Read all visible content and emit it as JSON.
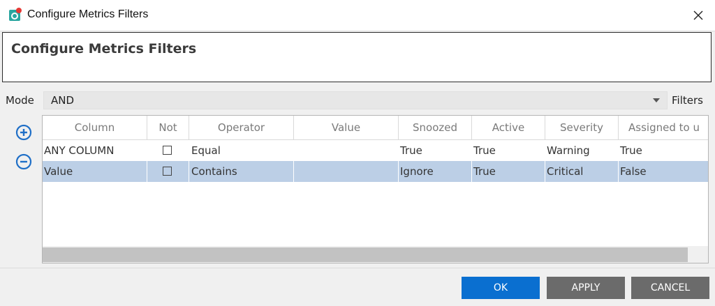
{
  "window": {
    "title": "Configure Metrics Filters"
  },
  "header": {
    "title": "Configure Metrics Filters"
  },
  "mode": {
    "label": "Mode",
    "value": "AND",
    "filters_label": "Filters"
  },
  "table": {
    "columns": [
      "Column",
      "Not",
      "Operator",
      "Value",
      "Snoozed",
      "Active",
      "Severity",
      "Assigned to u"
    ],
    "rows": [
      {
        "column": "ANY COLUMN",
        "not": false,
        "operator": "Equal",
        "value": "",
        "snoozed": "True",
        "active": "True",
        "severity": "Warning",
        "assigned": "True"
      },
      {
        "column": "Value",
        "not": false,
        "operator": "Contains",
        "value": "",
        "snoozed": "Ignore",
        "active": "True",
        "severity": "Critical",
        "assigned": "False"
      }
    ]
  },
  "buttons": {
    "ok": "OK",
    "apply": "APPLY",
    "cancel": "CANCEL"
  },
  "colors": {
    "accent": "#0a6fd0",
    "selected_row": "#bccfe6",
    "secondary_button": "#6b6b6b",
    "add_remove_icon": "#1f6fc7"
  }
}
